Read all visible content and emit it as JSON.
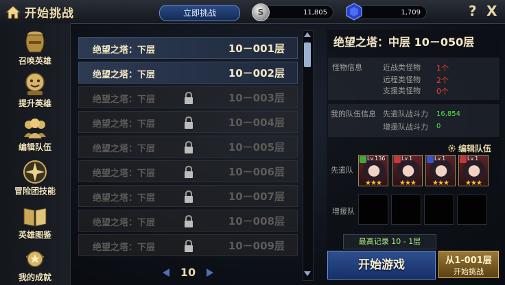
{
  "header": {
    "title": "开始挑战",
    "instant_challenge_label": "立即挑战",
    "silver": "11,805",
    "gems": "1,709",
    "help_label": "?",
    "close_label": "X"
  },
  "sidebar": {
    "items": [
      {
        "label": "召唤英雄",
        "icon": "urn-icon"
      },
      {
        "label": "提升英雄",
        "icon": "level-up-icon"
      },
      {
        "label": "编辑队伍",
        "icon": "team-icon"
      },
      {
        "label": "冒险团技能",
        "icon": "compass-icon"
      },
      {
        "label": "英雄图鉴",
        "icon": "book-icon"
      },
      {
        "label": "我的成就",
        "icon": "trophy-icon"
      }
    ]
  },
  "floor_list": {
    "rows": [
      {
        "name": "绝望之塔：下层",
        "floor": "10－001层",
        "locked": false
      },
      {
        "name": "绝望之塔：下层",
        "floor": "10－002层",
        "locked": false
      },
      {
        "name": "绝望之塔：下层",
        "floor": "10－003层",
        "locked": true
      },
      {
        "name": "绝望之塔：下层",
        "floor": "10－004层",
        "locked": true
      },
      {
        "name": "绝望之塔：下层",
        "floor": "10－005层",
        "locked": true
      },
      {
        "name": "绝望之塔：下层",
        "floor": "10－006层",
        "locked": true
      },
      {
        "name": "绝望之塔：下层",
        "floor": "10－007层",
        "locked": true
      },
      {
        "name": "绝望之塔：下层",
        "floor": "10－008层",
        "locked": true
      },
      {
        "name": "绝望之塔：下层",
        "floor": "10－009层",
        "locked": true
      }
    ],
    "page": "10"
  },
  "detail": {
    "title": "绝望之塔：中层 10－050层",
    "monster_section": "怪物信息",
    "monsters": [
      {
        "type": "近战类怪物",
        "count": "1个"
      },
      {
        "type": "远程类怪物",
        "count": "2个"
      },
      {
        "type": "支援类怪物",
        "count": "0个"
      }
    ],
    "team_section": "我的队伍信息",
    "vanguard_power_label": "先遣队战斗力",
    "vanguard_power": "16,854",
    "support_power_label": "增援队战斗力",
    "support_power": "0",
    "edit_team_label": "编辑队伍",
    "vanguard_label": "先遣队",
    "support_label": "增援队",
    "vanguard_heroes": [
      {
        "level": "Lv.136",
        "stars": "★★★",
        "badge_color": "#3fa83f"
      },
      {
        "level": "Lv.1",
        "stars": "★★★",
        "badge_color": "#c23a3a"
      },
      {
        "level": "Lv.1",
        "stars": "★★★",
        "badge_color": "#3556c8"
      },
      {
        "level": "Lv.1",
        "stars": "★★★",
        "badge_color": "#c23a3a"
      }
    ],
    "best_record": "最高记录 10 - 1层",
    "start_game_label": "开始游戏",
    "start_challenge_floor": "从1-001层",
    "start_challenge_label": "开始挑战"
  },
  "colors": {
    "accent_blue": "#2e4f8e",
    "gold": "#f7c02d",
    "warning_red": "#ff3b2e",
    "power_green": "#58e34a"
  }
}
